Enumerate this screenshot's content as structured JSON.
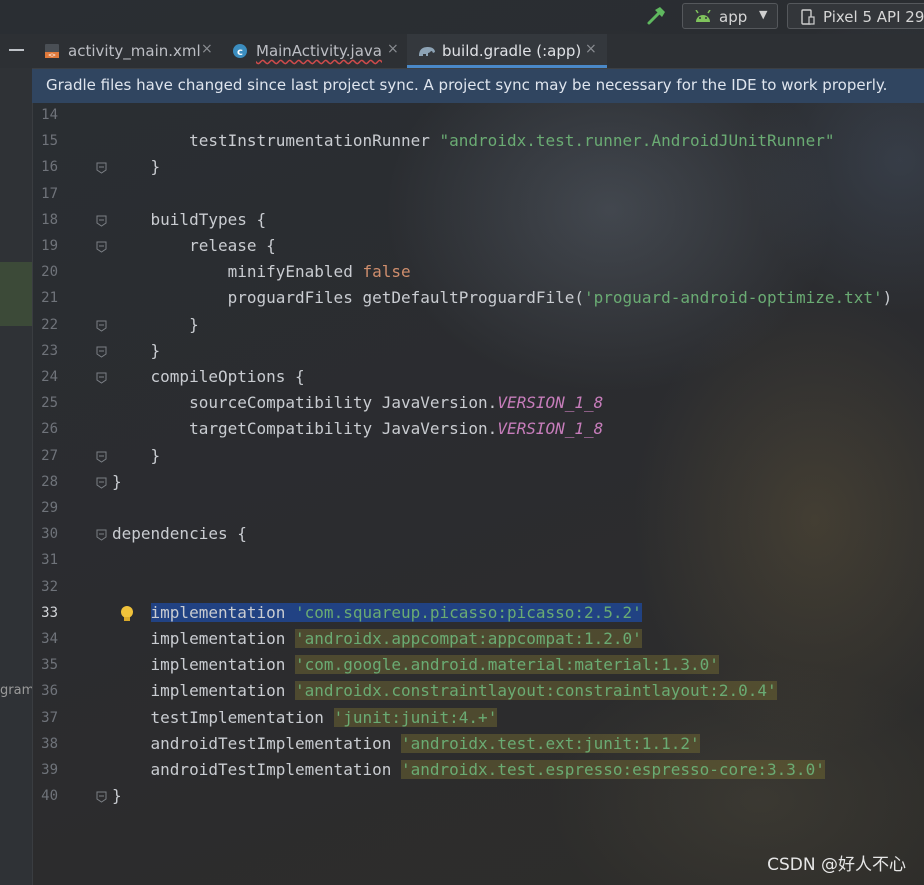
{
  "toolbar": {
    "run_config": "app",
    "device": "Pixel 5 API 29",
    "hammer_icon": "hammer-icon",
    "android_icon": "android-robot-icon",
    "device_icon": "phone-icon"
  },
  "tabs": [
    {
      "label": "activity_main.xml",
      "icon": "xml-layout-icon",
      "close": "×",
      "active": false
    },
    {
      "label": "MainActivity.java",
      "icon": "java-class-icon",
      "close": "×",
      "active": false
    },
    {
      "label": "build.gradle (:app)",
      "icon": "gradle-elephant-icon",
      "close": "×",
      "active": true
    }
  ],
  "banner": {
    "text": "Gradle files have changed since last project sync. A project sync may be necessary for the IDE to work properly."
  },
  "left_strip": {
    "text": "gram"
  },
  "editor": {
    "current_line": "33",
    "lines": [
      {
        "num": "14",
        "segments": []
      },
      {
        "num": "15",
        "segments": [
          {
            "t": "        testInstrumentationRunner ",
            "c": "blk"
          },
          {
            "t": "\"androidx.test.runner.AndroidJUnitRunner\"",
            "c": "str"
          }
        ]
      },
      {
        "num": "16",
        "segments": [
          {
            "t": "    }",
            "c": "blk"
          }
        ]
      },
      {
        "num": "17",
        "segments": []
      },
      {
        "num": "18",
        "segments": [
          {
            "t": "    buildTypes ",
            "c": "blk"
          },
          {
            "t": "{",
            "c": "blk"
          }
        ]
      },
      {
        "num": "19",
        "segments": [
          {
            "t": "        release {",
            "c": "blk"
          }
        ]
      },
      {
        "num": "20",
        "segments": [
          {
            "t": "            minifyEnabled ",
            "c": "blk"
          },
          {
            "t": "false",
            "c": "kw"
          }
        ]
      },
      {
        "num": "21",
        "segments": [
          {
            "t": "            proguardFiles getDefaultProguardFile(",
            "c": "blk"
          },
          {
            "t": "'proguard-android-optimize.txt'",
            "c": "str"
          },
          {
            "t": ")",
            "c": "blk"
          }
        ]
      },
      {
        "num": "22",
        "segments": [
          {
            "t": "        }",
            "c": "blk"
          }
        ]
      },
      {
        "num": "23",
        "segments": [
          {
            "t": "    }",
            "c": "blk"
          }
        ]
      },
      {
        "num": "24",
        "segments": [
          {
            "t": "    compileOptions {",
            "c": "blk"
          }
        ]
      },
      {
        "num": "25",
        "segments": [
          {
            "t": "        sourceCompatibility JavaVersion.",
            "c": "blk"
          },
          {
            "t": "VERSION_1_8",
            "c": "const"
          }
        ]
      },
      {
        "num": "26",
        "segments": [
          {
            "t": "        targetCompatibility JavaVersion.",
            "c": "blk"
          },
          {
            "t": "VERSION_1_8",
            "c": "const"
          }
        ]
      },
      {
        "num": "27",
        "segments": [
          {
            "t": "    }",
            "c": "blk"
          }
        ]
      },
      {
        "num": "28",
        "segments": [
          {
            "t": "}",
            "c": "blk"
          }
        ]
      },
      {
        "num": "29",
        "segments": []
      },
      {
        "num": "30",
        "segments": [
          {
            "t": "dependencies {",
            "c": "blk"
          }
        ]
      },
      {
        "num": "31",
        "segments": []
      },
      {
        "num": "32",
        "segments": []
      },
      {
        "num": "33",
        "segments": [
          {
            "t": "    ",
            "c": "blk"
          },
          {
            "t": "implementation ",
            "c": "blk sel"
          },
          {
            "t": "'com.squareup.picasso:picasso:2.5.2'",
            "c": "str sel"
          }
        ]
      },
      {
        "num": "34",
        "segments": [
          {
            "t": "    implementation ",
            "c": "blk"
          },
          {
            "t": "'androidx.appcompat:appcompat:1.2.0'",
            "c": "str hl-str"
          }
        ]
      },
      {
        "num": "35",
        "segments": [
          {
            "t": "    implementation ",
            "c": "blk"
          },
          {
            "t": "'com.google.android.material:material:1.3.0'",
            "c": "str hl-str"
          }
        ]
      },
      {
        "num": "36",
        "segments": [
          {
            "t": "    implementation ",
            "c": "blk"
          },
          {
            "t": "'androidx.constraintlayout:constraintlayout:2.0.4'",
            "c": "str hl-str"
          }
        ]
      },
      {
        "num": "37",
        "segments": [
          {
            "t": "    testImplementation ",
            "c": "blk"
          },
          {
            "t": "'junit:junit:4.+'",
            "c": "str hl-str"
          }
        ]
      },
      {
        "num": "38",
        "segments": [
          {
            "t": "    androidTestImplementation ",
            "c": "blk"
          },
          {
            "t": "'androidx.test.ext:junit:1.1.2'",
            "c": "str hl-str"
          }
        ]
      },
      {
        "num": "39",
        "segments": [
          {
            "t": "    androidTestImplementation ",
            "c": "blk"
          },
          {
            "t": "'androidx.test.espresso:espresso-core:3.3.0'",
            "c": "str hl-str"
          }
        ]
      },
      {
        "num": "40",
        "segments": [
          {
            "t": "}",
            "c": "blk"
          }
        ]
      }
    ],
    "fold_markers": [
      "16",
      "18",
      "19",
      "22",
      "23",
      "24",
      "27",
      "28",
      "30",
      "40"
    ]
  },
  "watermark": "CSDN @好人不心"
}
